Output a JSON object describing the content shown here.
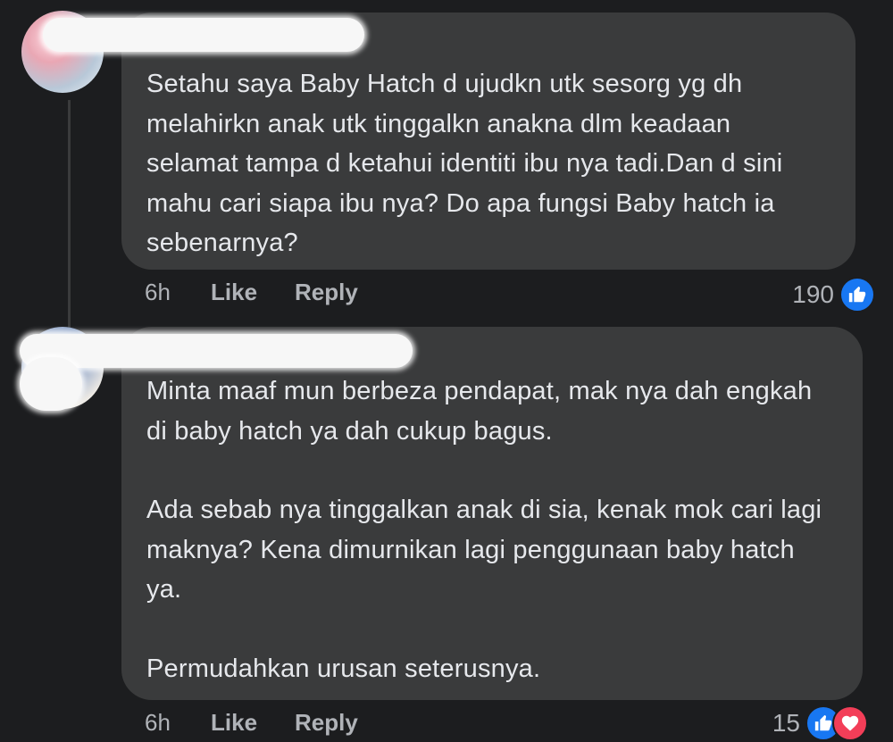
{
  "comments": [
    {
      "text": [
        "Setahu saya Baby Hatch d ujudkn utk sesorg yg dh melahirkn anak utk tinggalkn anakna dlm keadaan selamat tampa d ketahui identiti ibu nya tadi.Dan d sini mahu cari siapa ibu nya? Do apa fungsi Baby hatch ia sebenarnya?"
      ],
      "time": "6h",
      "like_label": "Like",
      "reply_label": "Reply",
      "reaction_count": "190",
      "reactions": [
        "like-icon"
      ]
    },
    {
      "text": [
        "Minta maaf mun berbeza pendapat, mak nya dah engkah di baby hatch ya dah cukup bagus.",
        "Ada sebab nya tinggalkan anak di sia, kenak mok cari lagi maknya? Kena dimurnikan lagi penggunaan baby hatch ya.",
        "Permudahkan urusan seterusnya."
      ],
      "time": "6h",
      "like_label": "Like",
      "reply_label": "Reply",
      "reaction_count": "15",
      "reactions": [
        "like-icon",
        "love-icon"
      ]
    }
  ],
  "colors": {
    "background": "#1c1d1f",
    "bubble": "#3a3b3c",
    "like_blue": "#1877f2",
    "love_red": "#f33e58"
  }
}
